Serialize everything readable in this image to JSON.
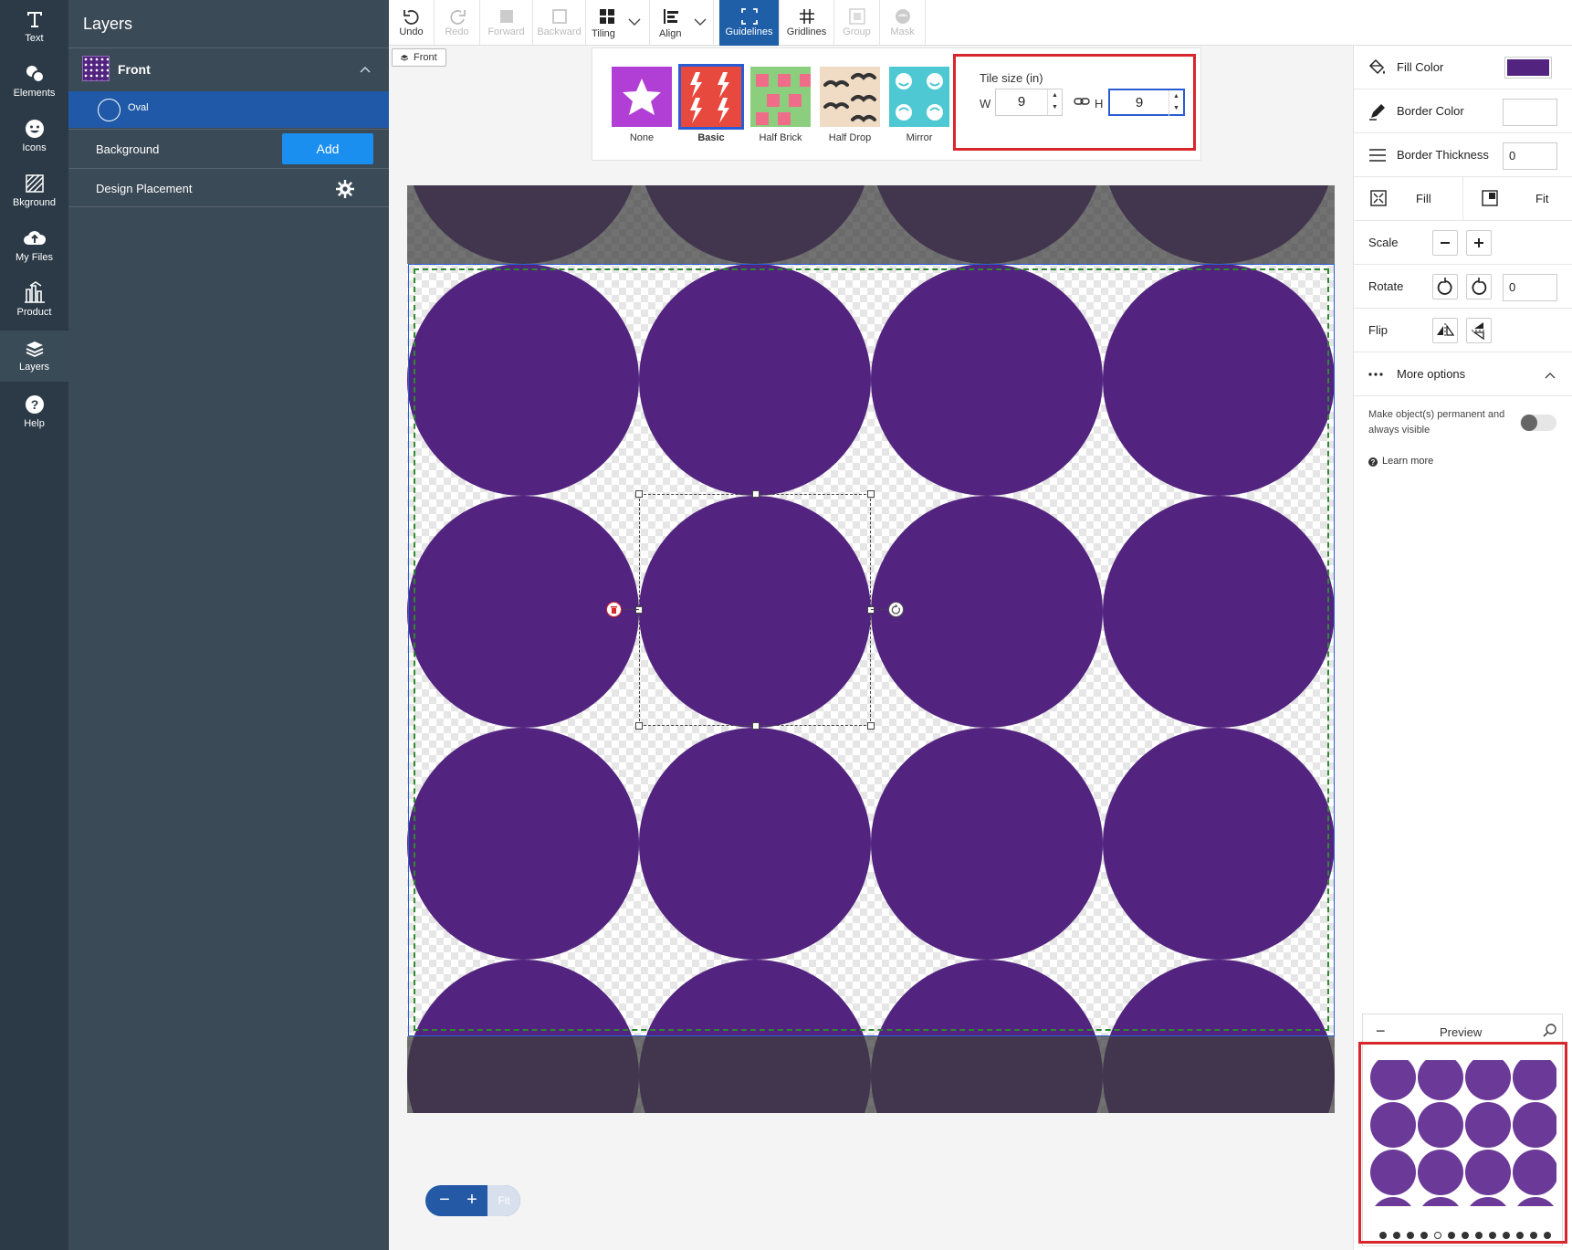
{
  "rail": {
    "items": [
      {
        "label": "Text",
        "icon": "text-icon"
      },
      {
        "label": "Elements",
        "icon": "elements-icon"
      },
      {
        "label": "Icons",
        "icon": "smiley-icon"
      },
      {
        "label": "Bkground",
        "icon": "background-icon"
      },
      {
        "label": "My Files",
        "icon": "cloud-upload-icon"
      },
      {
        "label": "Product",
        "icon": "product-icon"
      },
      {
        "label": "Layers",
        "icon": "layers-icon"
      },
      {
        "label": "Help",
        "icon": "help-icon"
      }
    ],
    "active": "Layers"
  },
  "layers_panel": {
    "title": "Layers",
    "group": {
      "label": "Front",
      "expanded": true
    },
    "layer_item": {
      "label": "Oval"
    },
    "background": {
      "label": "Background",
      "button": "Add"
    },
    "placement": {
      "label": "Design Placement"
    }
  },
  "toolbar": {
    "undo": "Undo",
    "redo": "Redo",
    "forward": "Forward",
    "backward": "Backward",
    "tiling": "Tiling",
    "align": "Align",
    "guidelines": "Guidelines",
    "gridlines": "Gridlines",
    "group": "Group",
    "mask": "Mask"
  },
  "canvas_tag": "Front",
  "tiling": {
    "options": [
      {
        "label": "None",
        "color": "#b13fd6"
      },
      {
        "label": "Basic",
        "color": "#e8493f"
      },
      {
        "label": "Half Brick",
        "color": "#8bcf7e"
      },
      {
        "label": "Half Drop",
        "color": "#f0dcc4"
      },
      {
        "label": "Mirror",
        "color": "#4ec8d3"
      }
    ],
    "selected": "Basic",
    "tile_size": {
      "title": "Tile size (in)",
      "w_label": "W",
      "w_value": "9",
      "h_label": "H",
      "h_value": "9"
    }
  },
  "canvas": {
    "dot_color": "#52247f",
    "bleed_color": "#1c0a2e"
  },
  "properties": {
    "fill_color": {
      "label": "Fill Color",
      "value": "#52247f"
    },
    "border_color": {
      "label": "Border Color"
    },
    "border_thickness": {
      "label": "Border Thickness",
      "value": "0"
    },
    "fill": "Fill",
    "fit": "Fit",
    "scale": "Scale",
    "rotate": {
      "label": "Rotate",
      "value": "0"
    },
    "flip": "Flip",
    "more_options": "More options",
    "permanent": {
      "label": "Make object(s) permanent and always visible",
      "on": false
    },
    "learn_more": "Learn more"
  },
  "zoom": {
    "minus": "−",
    "plus": "+",
    "fit": "Fit"
  },
  "preview": {
    "title": "Preview",
    "pages": 13,
    "active_page": 5,
    "dot_color": "#6b3a98"
  }
}
